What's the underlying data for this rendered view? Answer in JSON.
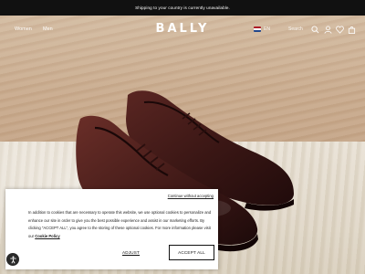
{
  "announcement": "Shipping to your country is currently unavailable.",
  "nav": {
    "links": [
      "Women",
      "Men"
    ],
    "logo": "BALLY",
    "language": "EN",
    "search_label": "Search"
  },
  "cookie_banner": {
    "close_link": "Continue without accepting",
    "text": "In addition to cookies that are necessary to operate this website, we use optional cookies to personalize and enhance our site in order to give you the best possible experience and assist in our marketing efforts. By clicking \"ACCEPT ALL\", you agree to the storing of these optional cookies. For more information please visit our ",
    "policy_link": "Cookie Policy",
    "adjust_label": "ADJUST",
    "accept_label": "ACCEPT ALL"
  },
  "colors": {
    "announcement_bg": "#111111",
    "leather": "#3a1716",
    "banner_bg": "#ffffff"
  },
  "icons": [
    "search-icon",
    "user-icon",
    "heart-icon",
    "bag-icon",
    "accessibility-icon"
  ]
}
